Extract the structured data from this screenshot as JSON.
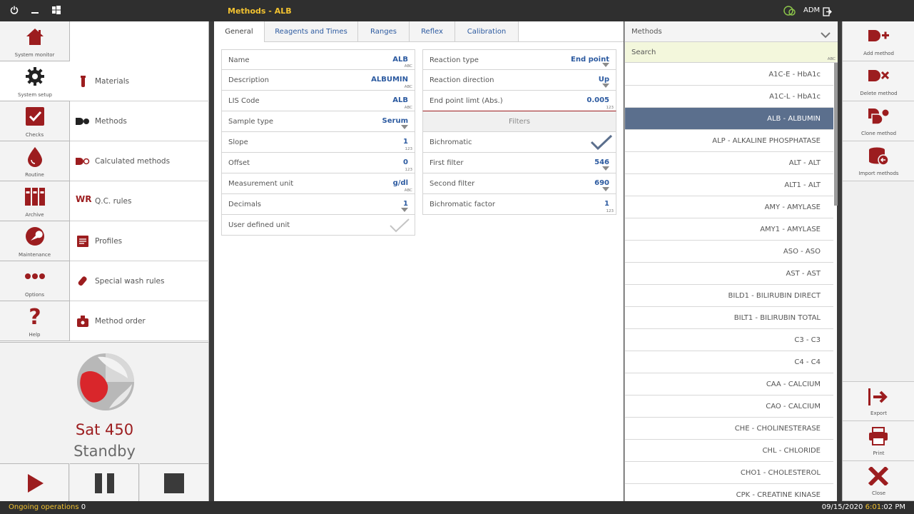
{
  "window": {
    "title": "Methods - ALB",
    "user": "ADM"
  },
  "nav": [
    {
      "label": "System monitor",
      "icon": "house-icon"
    },
    {
      "label": "System setup",
      "icon": "gear-icon"
    },
    {
      "label": "Checks",
      "icon": "checkbox-icon"
    },
    {
      "label": "Routine",
      "icon": "drop-icon"
    },
    {
      "label": "Archive",
      "icon": "binders-icon"
    },
    {
      "label": "Maintenance",
      "icon": "wrench-icon"
    },
    {
      "label": "Options",
      "icon": "dots-icon"
    },
    {
      "label": "Help",
      "icon": "question-icon"
    }
  ],
  "submenu": [
    {
      "label": "Materials"
    },
    {
      "label": "Methods"
    },
    {
      "label": "Calculated methods"
    },
    {
      "label": "Q.C. rules",
      "icon_text": "WR"
    },
    {
      "label": "Profiles"
    },
    {
      "label": "Special wash rules"
    },
    {
      "label": "Method order"
    }
  ],
  "instrument": {
    "name": "Sat 450",
    "state": "Standby"
  },
  "tabs": [
    "General",
    "Reagents and Times",
    "Ranges",
    "Reflex",
    "Calibration"
  ],
  "form_left": [
    {
      "label": "Name",
      "value": "ALB",
      "tag": "ABC"
    },
    {
      "label": "Description",
      "value": "ALBUMIN",
      "tag": "ABC"
    },
    {
      "label": "LIS Code",
      "value": "ALB",
      "tag": "ABC"
    },
    {
      "label": "Sample type",
      "value": "Serum",
      "tag": ""
    },
    {
      "label": "Slope",
      "value": "1",
      "tag": "123"
    },
    {
      "label": "Offset",
      "value": "0",
      "tag": "123"
    },
    {
      "label": "Measurement unit",
      "value": "g/dl",
      "tag": "ABC"
    },
    {
      "label": "Decimals",
      "value": "1",
      "tag": ""
    },
    {
      "label": "User defined unit",
      "value": "",
      "tag": ""
    }
  ],
  "form_right": [
    {
      "label": "Reaction type",
      "value": "End point",
      "tag": ""
    },
    {
      "label": "Reaction direction",
      "value": "Up",
      "tag": ""
    },
    {
      "label": "End point limt (Abs.)",
      "value": "0.005",
      "tag": "123"
    },
    {
      "label": "Filters",
      "value": "",
      "tag": ""
    },
    {
      "label": "Bichromatic",
      "value": "",
      "tag": ""
    },
    {
      "label": "First filter",
      "value": "546",
      "tag": ""
    },
    {
      "label": "Second filter",
      "value": "690",
      "tag": ""
    },
    {
      "label": "Bichromatic factor",
      "value": "1",
      "tag": "123"
    }
  ],
  "methods_panel": {
    "header": "Methods",
    "search_placeholder": "Search",
    "search_tag": "ABC",
    "items": [
      "A1C-E - HbA1c",
      "A1C-L - HbA1c",
      "ALB - ALBUMIN",
      "ALP - ALKALINE PHOSPHATASE",
      "ALT - ALT",
      "ALT1 - ALT",
      "AMY - AMYLASE",
      "AMY1 - AMYLASE",
      "ASO - ASO",
      "AST - AST",
      "BILD1 - BILIRUBIN DIRECT",
      "BILT1 - BILIRUBIN TOTAL",
      "C3 - C3",
      "C4 - C4",
      "CAA - CALCIUM",
      "CAO - CALCIUM",
      "CHE - CHOLINESTERASE",
      "CHL - CHLORIDE",
      "CHO1 - CHOLESTEROL",
      "CPK - CREATINE KINASE"
    ],
    "selected": "ALB - ALBUMIN"
  },
  "actions": [
    {
      "label": "Add method",
      "icon": "add-method-icon"
    },
    {
      "label": "Delete method",
      "icon": "delete-method-icon"
    },
    {
      "label": "Clone method",
      "icon": "clone-method-icon"
    },
    {
      "label": "Import methods",
      "icon": "import-methods-icon"
    },
    {
      "label": "Export",
      "icon": "export-icon"
    },
    {
      "label": "Print",
      "icon": "printer-icon"
    },
    {
      "label": "Close",
      "icon": "close-icon"
    }
  ],
  "status": {
    "ongoing_label": "Ongoing operations",
    "ongoing_count": "0",
    "date": "09/15/2020",
    "time_hm": "6:01",
    "time_s": ":02 PM"
  },
  "colors": {
    "brand_red": "#9c1d1f",
    "accent_blue": "#2c5aa0",
    "selected_row": "#5b6f8d",
    "status_yellow": "#f2c230"
  }
}
